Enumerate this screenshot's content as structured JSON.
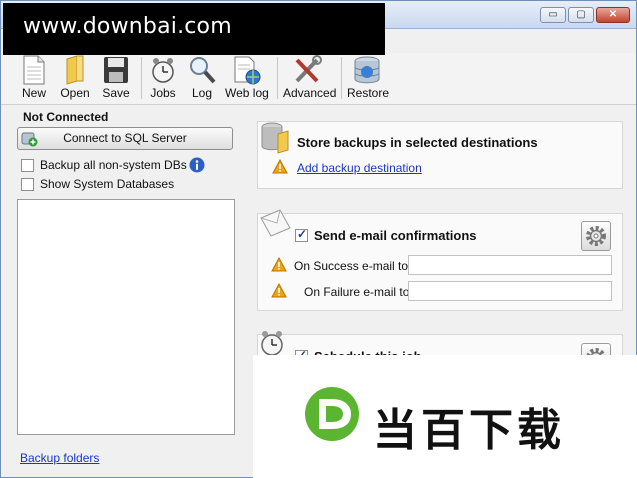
{
  "watermark": {
    "site": "www.downbai.com",
    "brand": "当百下载"
  },
  "window": {
    "buttons": {
      "minimize": "▭",
      "maximize": "▢",
      "close": "✕"
    }
  },
  "toolbar": {
    "items": [
      {
        "label": "New",
        "icon": "new-document-icon"
      },
      {
        "label": "Open",
        "icon": "open-folder-icon"
      },
      {
        "label": "Save",
        "icon": "save-floppy-icon"
      },
      {
        "label": "Jobs",
        "icon": "alarm-clock-icon"
      },
      {
        "label": "Log",
        "icon": "magnifier-icon"
      },
      {
        "label": "Web log",
        "icon": "web-log-icon"
      },
      {
        "label": "Advanced",
        "icon": "tools-icon"
      },
      {
        "label": "Restore",
        "icon": "database-restore-icon"
      }
    ]
  },
  "left": {
    "status": "Not Connected",
    "connect_label": "Connect to SQL Server",
    "backup_all_label": "Backup all non-system DBs",
    "backup_all_checked": false,
    "show_system_label": "Show System Databases",
    "show_system_checked": false,
    "backup_folders_link": "Backup folders"
  },
  "destinations": {
    "title": "Store backups in selected destinations",
    "add_link": "Add backup destination"
  },
  "email": {
    "title": "Send e-mail confirmations",
    "checked": true,
    "success_label": "On Success e-mail to:",
    "success_value": "",
    "failure_label": "On Failure e-mail to:",
    "failure_value": ""
  },
  "schedule": {
    "title": "Schedule this job",
    "checked": true
  },
  "colors": {
    "accent": "#1b35c7",
    "warning": "#f0a30a",
    "watermark_green": "#5cb531"
  }
}
